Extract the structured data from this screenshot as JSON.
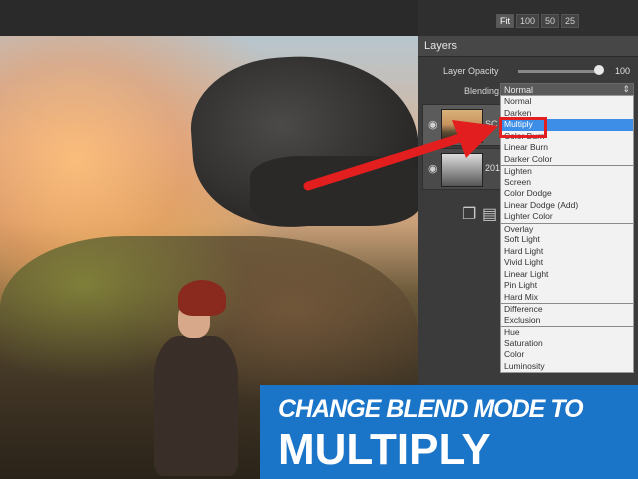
{
  "toolbar": {
    "zoom_buttons": [
      "Fit",
      "100",
      "50",
      "25"
    ]
  },
  "layers_panel": {
    "title": "Layers",
    "opacity_label": "Layer Opacity",
    "opacity_value": "100",
    "opacity_level": 1.0,
    "blending_label": "Blending",
    "blending_value": "Normal",
    "layers": [
      {
        "name": "SC",
        "icon": "eye-icon"
      },
      {
        "name": "201",
        "icon": "eye-icon"
      }
    ],
    "bottom_icons": [
      "duplicate-layer-icon",
      "new-layer-icon"
    ]
  },
  "blend_dropdown": {
    "options": [
      "Normal",
      "Darken",
      "Multiply",
      "Color Burn",
      "Linear Burn",
      "Darker Color",
      "Lighten",
      "Screen",
      "Color Dodge",
      "Linear Dodge (Add)",
      "Lighter Color",
      "Overlay",
      "Soft Light",
      "Hard Light",
      "Vivid Light",
      "Linear Light",
      "Pin Light",
      "Hard Mix",
      "Difference",
      "Exclusion",
      "Hue",
      "Saturation",
      "Color",
      "Luminosity"
    ],
    "selected": "Multiply"
  },
  "banner": {
    "line1": "CHANGE BLEND MODE TO",
    "line2": "MULTIPLY"
  },
  "colors": {
    "accent": "#e31e1e",
    "selection": "#3d8ee6",
    "banner": "#1a74c7"
  }
}
